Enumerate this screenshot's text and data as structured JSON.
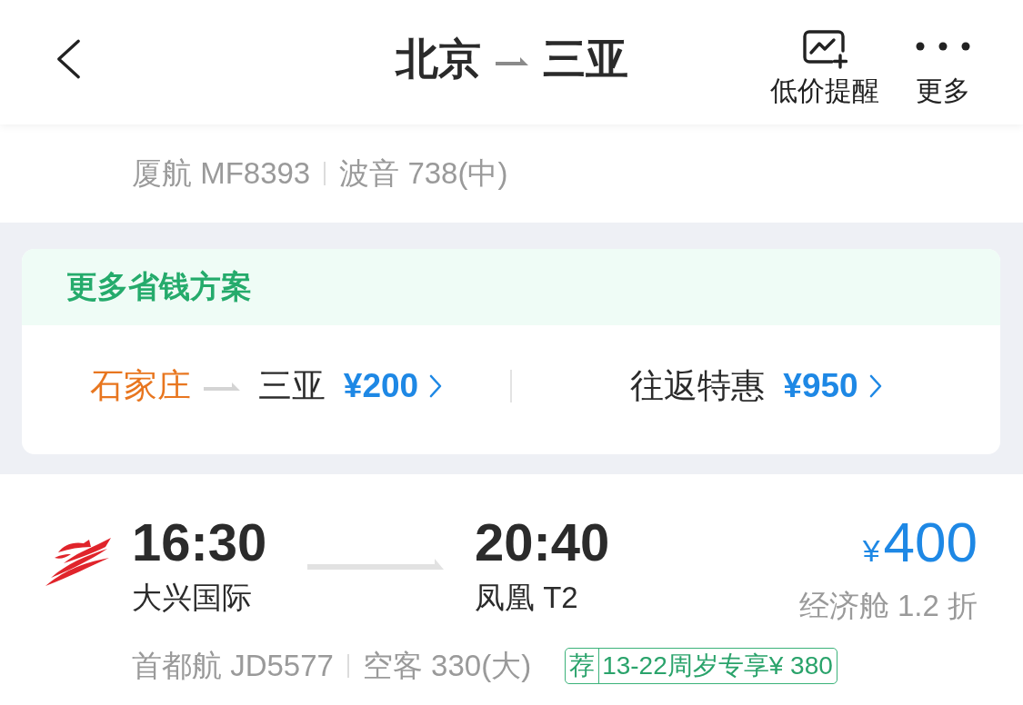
{
  "header": {
    "from": "北京",
    "to": "三亚",
    "actions": [
      {
        "kind": "alert",
        "label": "低价提醒"
      },
      {
        "kind": "more",
        "label": "更多"
      }
    ]
  },
  "previous_flight": {
    "airline_flight": "厦航 MF8393",
    "aircraft": "波音 738(中)"
  },
  "savings_card": {
    "title": "更多省钱方案",
    "offers": [
      {
        "kind": "route",
        "from": "石家庄",
        "to": "三亚",
        "price": "¥200"
      },
      {
        "kind": "deal",
        "label": "往返特惠",
        "price": "¥950"
      }
    ]
  },
  "flight": {
    "depart_time": "16:30",
    "depart_airport": "大兴国际",
    "arrive_time": "20:40",
    "arrive_airport": "凤凰 T2",
    "currency": "¥",
    "price": "400",
    "cabin": "经济舱 1.2 折",
    "airline_flight": "首都航 JD5577",
    "aircraft": "空客 330(大)",
    "tag": {
      "badge": "荐",
      "text": "13-22周岁专享¥ 380"
    }
  }
}
